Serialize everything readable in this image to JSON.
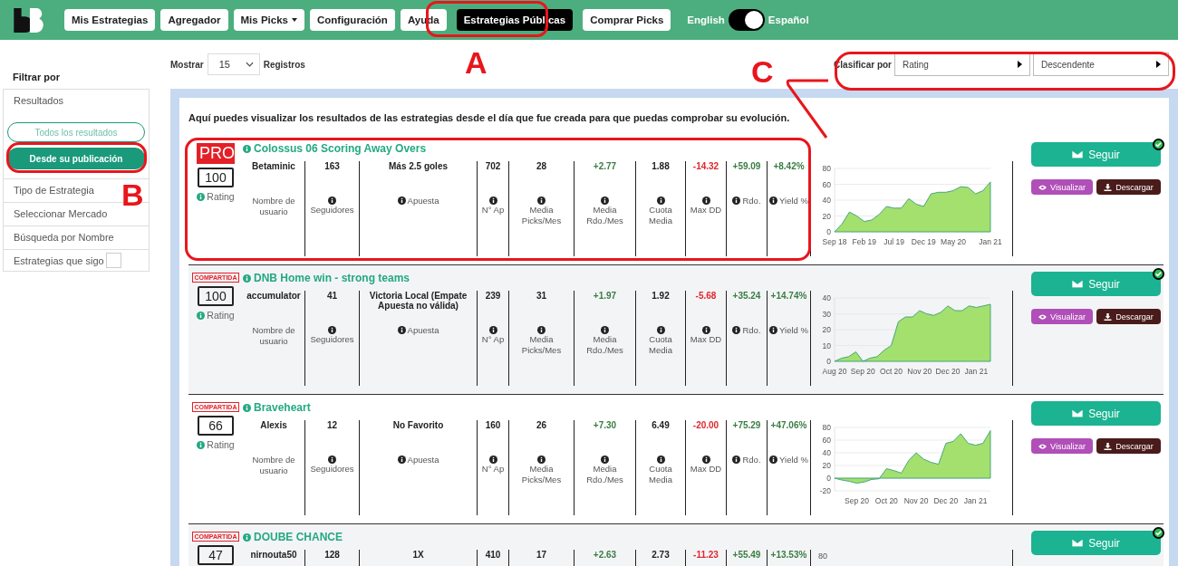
{
  "header": {
    "nav": [
      {
        "label": "Mis Estrategias",
        "selected": false,
        "dropdown": false
      },
      {
        "label": "Agregador",
        "selected": false,
        "dropdown": false
      },
      {
        "label": "Mis Picks",
        "selected": false,
        "dropdown": true
      },
      {
        "label": "Configuración",
        "selected": false,
        "dropdown": false
      },
      {
        "label": "Ayuda",
        "selected": false,
        "dropdown": false
      },
      {
        "label": "Estrategias Públicas",
        "selected": true,
        "dropdown": false
      },
      {
        "label": "Comprar Picks",
        "selected": false,
        "dropdown": false
      }
    ],
    "language": {
      "left": "English",
      "right": "Español",
      "on": true
    }
  },
  "sidebar": {
    "title": "Filtrar por",
    "sections": [
      {
        "kind": "group",
        "label": "Resultados",
        "options": [
          {
            "label": "Todos los resultados",
            "selected": false
          },
          {
            "label": "Desde su publicación",
            "selected": true
          }
        ]
      },
      {
        "kind": "item",
        "label": "Tipo de Estrategia"
      },
      {
        "kind": "item",
        "label": "Seleccionar Mercado"
      },
      {
        "kind": "item",
        "label": "Búsqueda por Nombre"
      },
      {
        "kind": "checkbox",
        "label": "Estrategias que sigo",
        "checked": false
      }
    ]
  },
  "toolbar": {
    "show_label": "Mostrar",
    "page_size": "15",
    "records_label": "Registros",
    "sort_label": "Clasificar por",
    "sort_field": "Rating",
    "sort_order": "Descendente"
  },
  "intro": "Aquí puedes visualizar los resultados de las estrategias desde el día que fue creada para que puedas comprobar su evolución.",
  "strategies": [
    {
      "badge": {
        "kind": "pro",
        "text": "PRO"
      },
      "rating": "100",
      "rating_label": "Rating",
      "title": "Colossus 06 Scoring Away Overs",
      "stats": [
        {
          "value": "Betaminic",
          "label": "Nombre de usuario",
          "info": false,
          "color": "#222222"
        },
        {
          "value": "163",
          "label": "Seguidores",
          "info": true,
          "color": "#222222"
        },
        {
          "value": "Más 2.5 goles",
          "label": "Apuesta",
          "info": true,
          "color": "#222222"
        },
        {
          "value": "702",
          "label": "N° Ap",
          "info": true,
          "color": "#222222"
        },
        {
          "value": "28",
          "label": "Media Picks/Mes",
          "info": true,
          "color": "#222222"
        },
        {
          "value": "+2.77",
          "label": "Media Rdo./Mes",
          "info": true,
          "color": "#3a7d44"
        },
        {
          "value": "1.88",
          "label": "Cuota Media",
          "info": true,
          "color": "#222222"
        },
        {
          "value": "-14.32",
          "label": "Max DD",
          "info": true,
          "color": "#e0262e"
        },
        {
          "value": "+59.09",
          "label": "Rdo.",
          "info": true,
          "color": "#3a7d44"
        },
        {
          "value": "+8.42%",
          "label": "Yield %",
          "info": true,
          "color": "#3a7d44"
        }
      ],
      "chart_data": {
        "type": "area",
        "categories": [
          "Sep 18",
          null,
          null,
          null,
          "Feb 19",
          null,
          null,
          null,
          "Jul 19",
          null,
          null,
          null,
          "Dec 19",
          null,
          null,
          null,
          "May 20",
          null,
          null,
          null,
          null,
          "Jan 21"
        ],
        "series": [
          {
            "color": "#a3e06e",
            "values": [
              0,
              10,
              25,
              20,
              13,
              15,
              22,
              32,
              30,
              30,
              42,
              35,
              32,
              48,
              50,
              50,
              52,
              57,
              56,
              48,
              52,
              63
            ]
          }
        ],
        "ylim": [
          0,
          80
        ],
        "yticks": [
          0,
          20,
          40,
          60,
          80
        ],
        "grid": true
      },
      "follow": {
        "label": "Seguir",
        "followed": true
      },
      "view": "Visualizar",
      "download": "Descargar"
    },
    {
      "badge": {
        "kind": "shared",
        "text": "COMPARTIDA"
      },
      "rating": "100",
      "rating_label": "Rating",
      "title": "DNB Home win - strong teams",
      "stats": [
        {
          "value": "accumulator",
          "label": "Nombre de usuario",
          "info": false,
          "color": "#222222"
        },
        {
          "value": "41",
          "label": "Seguidores",
          "info": true,
          "color": "#222222"
        },
        {
          "value": "Victoria Local (Empate Apuesta no válida)",
          "label": "Apuesta",
          "info": true,
          "color": "#222222"
        },
        {
          "value": "239",
          "label": "N° Ap",
          "info": true,
          "color": "#222222"
        },
        {
          "value": "31",
          "label": "Media Picks/Mes",
          "info": true,
          "color": "#222222"
        },
        {
          "value": "+1.97",
          "label": "Media Rdo./Mes",
          "info": true,
          "color": "#3a7d44"
        },
        {
          "value": "1.92",
          "label": "Cuota Media",
          "info": true,
          "color": "#222222"
        },
        {
          "value": "-5.68",
          "label": "Max DD",
          "info": true,
          "color": "#e0262e"
        },
        {
          "value": "+35.24",
          "label": "Rdo.",
          "info": true,
          "color": "#3a7d44"
        },
        {
          "value": "+14.74%",
          "label": "Yield %",
          "info": true,
          "color": "#3a7d44"
        }
      ],
      "chart_data": {
        "type": "area",
        "categories": [
          "Aug 20",
          null,
          null,
          null,
          "Sep 20",
          null,
          null,
          null,
          "Oct 20",
          null,
          null,
          null,
          "Nov 20",
          null,
          null,
          null,
          "Dec 20",
          null,
          null,
          null,
          "Jan 21",
          null,
          null
        ],
        "series": [
          {
            "color": "#a3e06e",
            "values": [
              0,
              2,
              3,
              6,
              0,
              2,
              3,
              7,
              10,
              25,
              28,
              28,
              32,
              30,
              29,
              31,
              35,
              32,
              32,
              35,
              34,
              35,
              36
            ]
          }
        ],
        "ylim": [
          0,
          40
        ],
        "yticks": [
          0,
          10,
          20,
          30,
          40
        ],
        "grid": true
      },
      "follow": {
        "label": "Seguir",
        "followed": true
      },
      "view": "Visualizar",
      "download": "Descargar"
    },
    {
      "badge": {
        "kind": "shared",
        "text": "COMPARTIDA"
      },
      "rating": "66",
      "rating_label": "Rating",
      "title": "Braveheart",
      "stats": [
        {
          "value": "Alexis",
          "label": "Nombre de usuario",
          "info": false,
          "color": "#222222"
        },
        {
          "value": "12",
          "label": "Seguidores",
          "info": true,
          "color": "#222222"
        },
        {
          "value": "No Favorito",
          "label": "Apuesta",
          "info": true,
          "color": "#222222"
        },
        {
          "value": "160",
          "label": "N° Ap",
          "info": true,
          "color": "#222222"
        },
        {
          "value": "26",
          "label": "Media Picks/Mes",
          "info": true,
          "color": "#222222"
        },
        {
          "value": "+7.30",
          "label": "Media Rdo./Mes",
          "info": true,
          "color": "#3a7d44"
        },
        {
          "value": "6.49",
          "label": "Cuota Media",
          "info": true,
          "color": "#222222"
        },
        {
          "value": "-20.00",
          "label": "Max DD",
          "info": true,
          "color": "#e0262e"
        },
        {
          "value": "+75.29",
          "label": "Rdo.",
          "info": true,
          "color": "#3a7d44"
        },
        {
          "value": "+47.06%",
          "label": "Yield %",
          "info": true,
          "color": "#3a7d44"
        }
      ],
      "chart_data": {
        "type": "area",
        "categories": [
          null,
          null,
          null,
          "Sep 20",
          null,
          null,
          null,
          "Oct 20",
          null,
          null,
          null,
          "Nov 20",
          null,
          null,
          null,
          "Dec 20",
          null,
          null,
          null,
          "Jan 21",
          null,
          null
        ],
        "series": [
          {
            "color": "#a3e06e",
            "values": [
              0,
              -3,
              -5,
              -8,
              -6,
              -2,
              -1,
              15,
              12,
              8,
              28,
              40,
              30,
              25,
              22,
              55,
              58,
              70,
              55,
              52,
              55,
              75
            ]
          }
        ],
        "ylim": [
          -20,
          80
        ],
        "yticks": [
          -20,
          0,
          20,
          40,
          60,
          80
        ],
        "grid": true
      },
      "follow": {
        "label": "Seguir",
        "followed": false
      },
      "view": "Visualizar",
      "download": "Descargar"
    },
    {
      "badge": {
        "kind": "shared",
        "text": "COMPARTIDA"
      },
      "rating": "47",
      "title": "DOUBE CHANCE",
      "stats": [
        {
          "value": "nirnouta50",
          "color": "#222222"
        },
        {
          "value": "128",
          "color": "#222222"
        },
        {
          "value": "1X",
          "color": "#222222"
        },
        {
          "value": "410",
          "color": "#222222"
        },
        {
          "value": "17",
          "color": "#222222"
        },
        {
          "value": "+2.63",
          "color": "#3a7d44"
        },
        {
          "value": "2.73",
          "color": "#222222"
        },
        {
          "value": "-11.23",
          "color": "#e0262e"
        },
        {
          "value": "+55.49",
          "color": "#3a7d44"
        },
        {
          "value": "+13.53%",
          "color": "#3a7d44"
        }
      ],
      "chart_top_tick": "80",
      "follow": {
        "label": "Seguir",
        "followed": true
      }
    }
  ],
  "annotations": [
    {
      "label": "A",
      "kind": "callout"
    },
    {
      "label": "B",
      "kind": "callout"
    },
    {
      "label": "C",
      "kind": "linked"
    }
  ]
}
